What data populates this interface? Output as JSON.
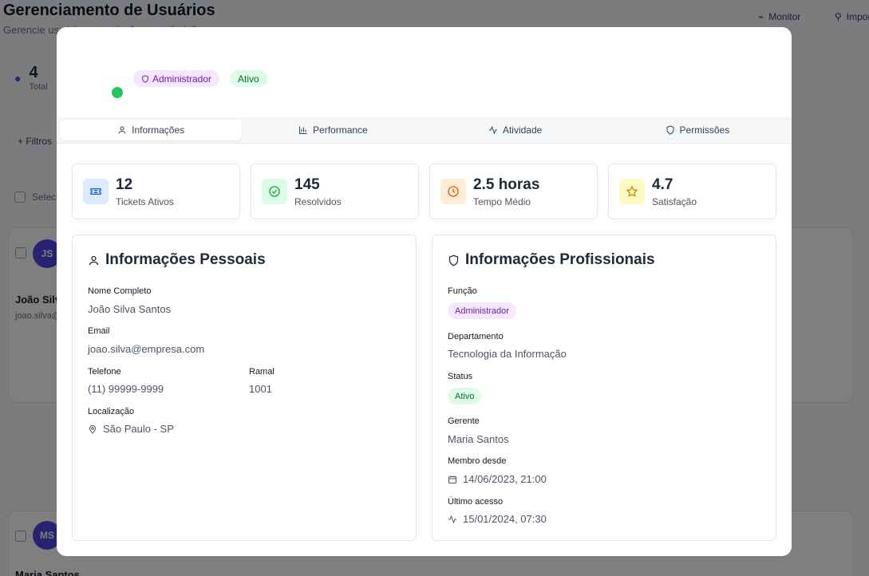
{
  "background": {
    "title": "Gerenciamento de Usuários",
    "subtitle": "Gerencie usuários, permissões e atribuições",
    "top_buttons": [
      "Monitor",
      "Importar"
    ],
    "stat_value": "4",
    "stat_label": "Total",
    "filter_label": "Filtros",
    "select_all_label": "Selecionar todos",
    "cards": [
      {
        "avatar": "JS",
        "name": "João Silva Santos",
        "email": "joao.silva@empresa.com"
      },
      {
        "avatar": "MS",
        "name": "Maria Santos",
        "email": ""
      }
    ]
  },
  "modal": {
    "badges": {
      "role": "Administrador",
      "status": "Ativo"
    },
    "tabs": [
      {
        "label": "Informações",
        "icon": "user-icon",
        "active": true
      },
      {
        "label": "Performance",
        "icon": "bar-chart-icon",
        "active": false
      },
      {
        "label": "Atividade",
        "icon": "activity-icon",
        "active": false
      },
      {
        "label": "Permissões",
        "icon": "shield-icon",
        "active": false
      }
    ],
    "stats": [
      {
        "value": "12",
        "label": "Tickets Ativos",
        "icon": "ticket-icon",
        "bg": "#dbeafe",
        "fg": "#2563eb"
      },
      {
        "value": "145",
        "label": "Resolvidos",
        "icon": "check-circle-icon",
        "bg": "#dcfce7",
        "fg": "#16a34a"
      },
      {
        "value": "2.5 horas",
        "label": "Tempo Médio",
        "icon": "clock-icon",
        "bg": "#ffedd5",
        "fg": "#ea580c"
      },
      {
        "value": "4.7",
        "label": "Satisfação",
        "icon": "star-icon",
        "bg": "#fef9c3",
        "fg": "#ca8a04"
      }
    ],
    "personal": {
      "title": "Informações Pessoais",
      "name_label": "Nome Completo",
      "name": "João Silva Santos",
      "email_label": "Email",
      "email": "joao.silva@empresa.com",
      "phone_label": "Telefone",
      "phone": "(11) 99999-9999",
      "ext_label": "Ramal",
      "ext": "1001",
      "location_label": "Localização",
      "location": "São Paulo - SP"
    },
    "professional": {
      "title": "Informações Profissionais",
      "role_label": "Função",
      "role": "Administrador",
      "department_label": "Departamento",
      "department": "Tecnologia da Informação",
      "status_label": "Status",
      "status": "Ativo",
      "manager_label": "Gerente",
      "manager": "Maria Santos",
      "member_since_label": "Membro desde",
      "member_since": "14/06/2023, 21:00",
      "last_access_label": "Último acesso",
      "last_access": "15/01/2024, 07:30"
    }
  }
}
